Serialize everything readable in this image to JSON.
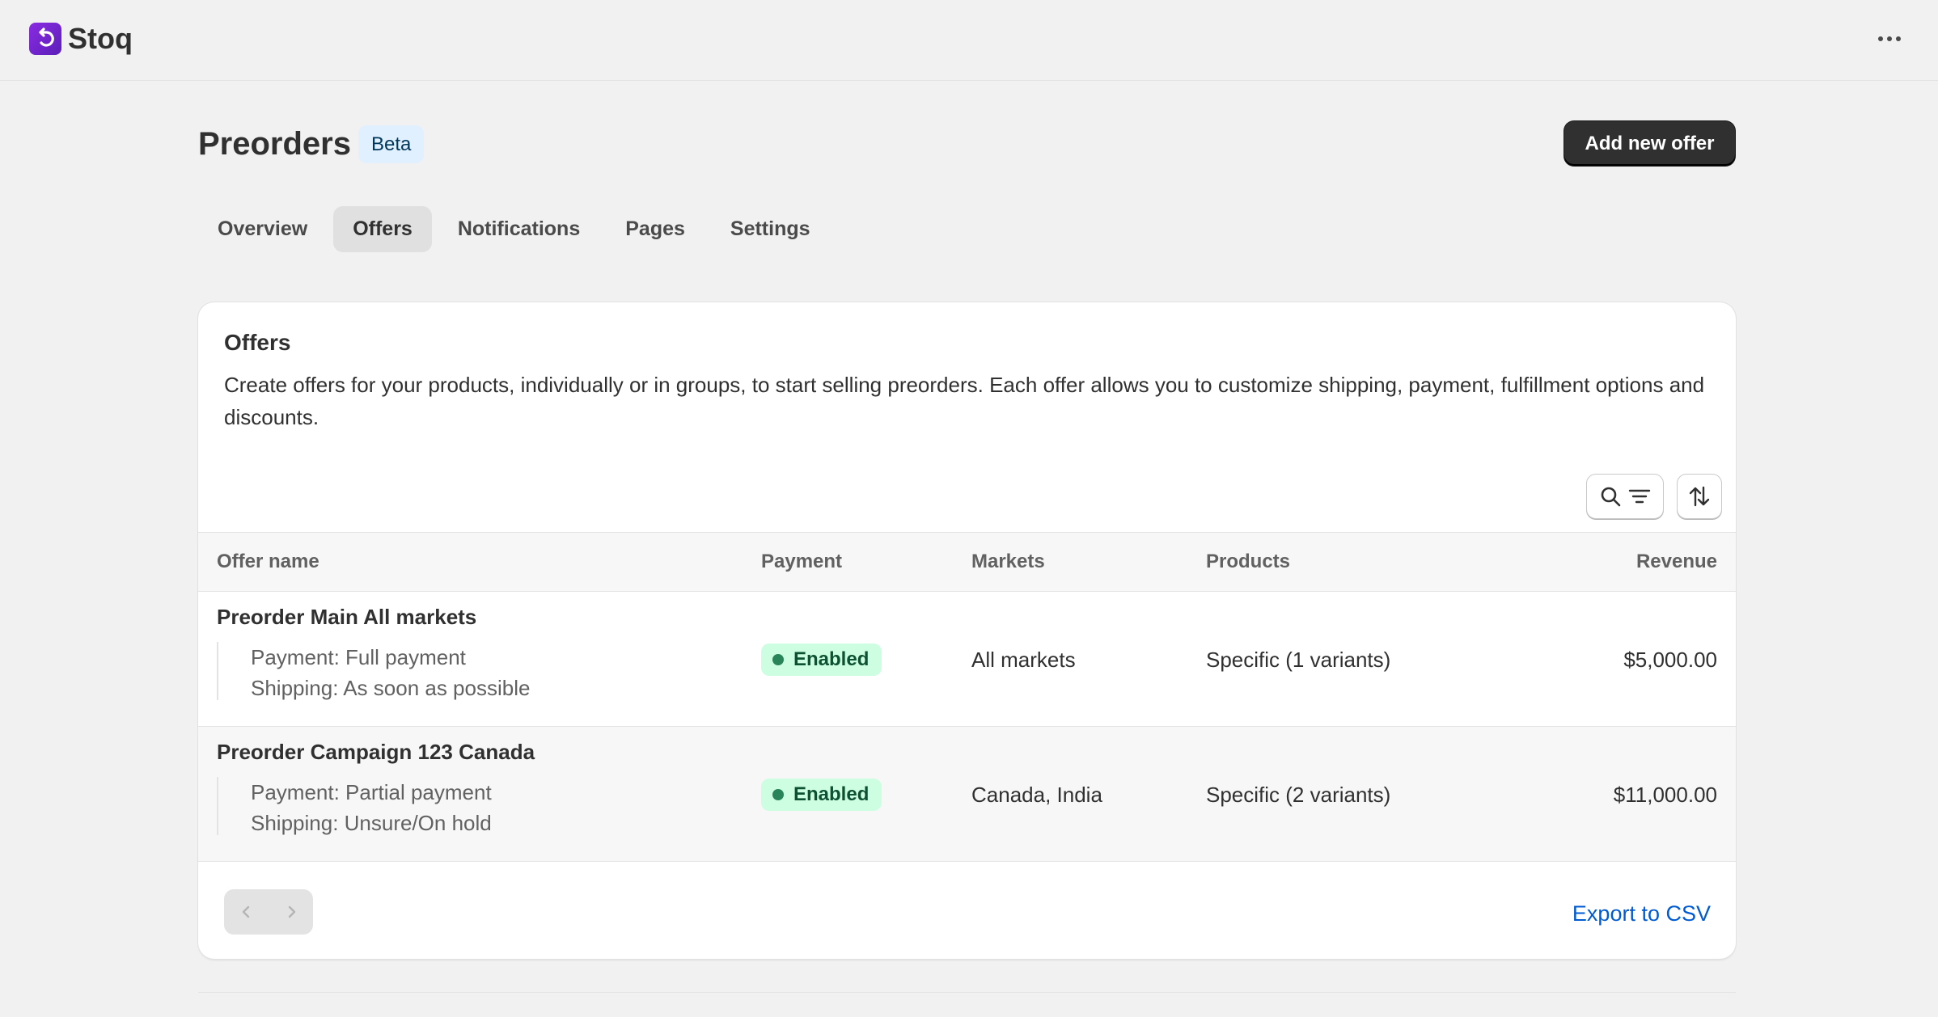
{
  "app": {
    "name": "Stoq"
  },
  "header": {
    "title": "Preorders",
    "badge": "Beta",
    "primary_action": "Add new offer"
  },
  "tabs": [
    {
      "label": "Overview",
      "active": false
    },
    {
      "label": "Offers",
      "active": true
    },
    {
      "label": "Notifications",
      "active": false
    },
    {
      "label": "Pages",
      "active": false
    },
    {
      "label": "Settings",
      "active": false
    }
  ],
  "card": {
    "title": "Offers",
    "description": "Create offers for your products, individually or in groups, to start selling preorders. Each offer allows you to customize shipping, payment, fulfillment options and discounts.",
    "tools": {
      "search_icon": "search-icon",
      "filter_icon": "filter-icon",
      "sort_icon": "sort-icon"
    }
  },
  "table": {
    "columns": [
      "Offer name",
      "Payment",
      "Markets",
      "Products",
      "Revenue"
    ],
    "rows": [
      {
        "name": "Preorder Main All markets",
        "payment_detail": "Payment: Full payment",
        "shipping_detail": "Shipping: As soon as possible",
        "status": "Enabled",
        "markets": "All markets",
        "products": "Specific (1 variants)",
        "revenue": "$5,000.00"
      },
      {
        "name": "Preorder Campaign 123 Canada",
        "payment_detail": "Payment: Partial payment",
        "shipping_detail": "Shipping: Unsure/On hold",
        "status": "Enabled",
        "markets": "Canada, India",
        "products": "Specific (2 variants)",
        "revenue": "$11,000.00"
      }
    ]
  },
  "footer": {
    "export_label": "Export to CSV"
  },
  "colors": {
    "brand": "#6b21c8",
    "status_enabled_bg": "#cdfee1",
    "link": "#005bd3"
  }
}
